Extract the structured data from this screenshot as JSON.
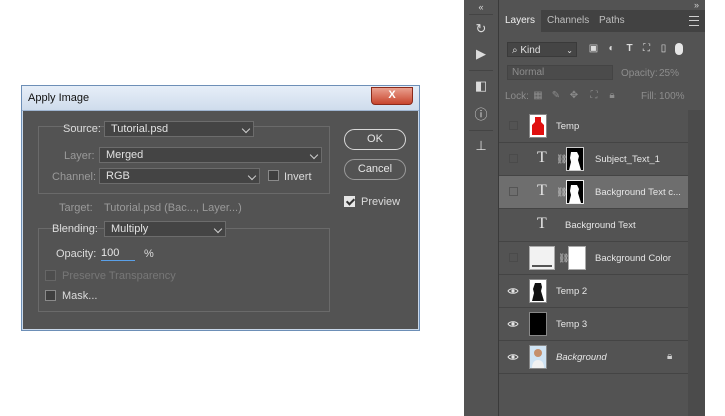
{
  "dialog": {
    "title": "Apply Image",
    "close_label": "X",
    "source": {
      "label": "Source:",
      "value": "Tutorial.psd"
    },
    "layer": {
      "label": "Layer:",
      "value": "Merged"
    },
    "channel": {
      "label": "Channel:",
      "value": "RGB"
    },
    "invert": {
      "label": "Invert",
      "checked": false
    },
    "target": {
      "label": "Target:",
      "value": "Tutorial.psd (Bac..., Layer...)"
    },
    "blending": {
      "label": "Blending:",
      "value": "Multiply"
    },
    "opacity": {
      "label": "Opacity:",
      "value": "100",
      "unit": "%"
    },
    "preserve_transparency": {
      "label": "Preserve Transparency",
      "enabled": false
    },
    "mask": {
      "label": "Mask...",
      "checked": false
    },
    "ok_label": "OK",
    "cancel_label": "Cancel",
    "preview": {
      "label": "Preview",
      "checked": true
    }
  },
  "panel": {
    "tabs": [
      {
        "label": "Layers",
        "active": true
      },
      {
        "label": "Channels",
        "active": false
      },
      {
        "label": "Paths",
        "active": false
      }
    ],
    "filter_label": "Kind",
    "blend_mode": "Normal",
    "opacity_label": "Opacity:",
    "opacity_value": "25%",
    "lock_label": "Lock:",
    "fill_label": "Fill:",
    "fill_value": "100%",
    "layers": [
      {
        "name": "Temp",
        "kind": "image",
        "visible": false,
        "selected": false
      },
      {
        "name": "Subject_Text_1",
        "kind": "text-mask",
        "visible": false,
        "selected": false
      },
      {
        "name": "Background Text c...",
        "kind": "text-mask",
        "visible": false,
        "selected": true
      },
      {
        "name": "Background Text",
        "kind": "text",
        "visible": false,
        "selected": false
      },
      {
        "name": "Background Color",
        "kind": "fill-mask",
        "visible": false,
        "selected": false
      },
      {
        "name": "Temp 2",
        "kind": "image",
        "visible": true,
        "selected": false
      },
      {
        "name": "Temp 3",
        "kind": "image",
        "visible": true,
        "selected": false
      },
      {
        "name": "Background",
        "kind": "image",
        "visible": true,
        "selected": false,
        "locked": true
      }
    ]
  },
  "colors": {
    "panel_bg": "#535353",
    "selected_row": "#6e6e6e",
    "accent_red": "#e01010",
    "focus_blue": "#5aa0e8"
  }
}
